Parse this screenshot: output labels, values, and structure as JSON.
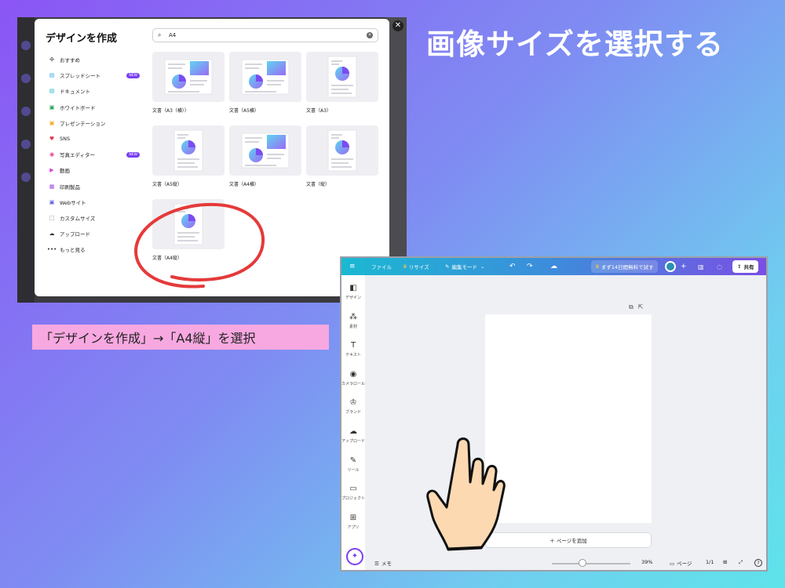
{
  "headline": "画像サイズを選択する",
  "caption": "「デザインを作成」→「A4縦」を選択",
  "dialog": {
    "title": "デザインを作成",
    "search_value": "A4",
    "close_icon": "✕",
    "sidebar": [
      {
        "label": "おすすめ",
        "icon": "sparkle-icon",
        "color": "#333333",
        "badge": ""
      },
      {
        "label": "スプレッドシート",
        "icon": "sheet-icon",
        "color": "#2aa8e0",
        "badge": "NEW"
      },
      {
        "label": "ドキュメント",
        "icon": "doc-icon",
        "color": "#1fb5c4",
        "badge": ""
      },
      {
        "label": "ホワイトボード",
        "icon": "whiteboard-icon",
        "color": "#1aa34a",
        "badge": ""
      },
      {
        "label": "プレゼンテーション",
        "icon": "presentation-icon",
        "color": "#f5a623",
        "badge": ""
      },
      {
        "label": "SNS",
        "icon": "heart-icon",
        "color": "#e5364b",
        "badge": ""
      },
      {
        "label": "写真エディター",
        "icon": "camera-icon",
        "color": "#e83e8c",
        "badge": "NEW"
      },
      {
        "label": "動画",
        "icon": "video-icon",
        "color": "#d63fd6",
        "badge": ""
      },
      {
        "label": "印刷製品",
        "icon": "printer-icon",
        "color": "#9b4de0",
        "badge": ""
      },
      {
        "label": "Webサイト",
        "icon": "website-icon",
        "color": "#5b5fe0",
        "badge": ""
      },
      {
        "label": "カスタムサイズ",
        "icon": "custom-size-icon",
        "color": "#333333",
        "badge": ""
      },
      {
        "label": "アップロード",
        "icon": "upload-icon",
        "color": "#333333",
        "badge": ""
      },
      {
        "label": "もっと見る",
        "icon": "more-icon",
        "color": "#333333",
        "badge": ""
      }
    ],
    "templates": [
      {
        "label": "文書（A3（横））",
        "orientation": "landscape"
      },
      {
        "label": "文書（A5横）",
        "orientation": "landscape"
      },
      {
        "label": "文書（A3）",
        "orientation": "portrait"
      },
      {
        "label": "文書（A5縦）",
        "orientation": "portrait"
      },
      {
        "label": "文書（A4横）",
        "orientation": "landscape"
      },
      {
        "label": "文書（縦）",
        "orientation": "portrait"
      },
      {
        "label": "文書（A4縦）",
        "orientation": "portrait"
      }
    ],
    "highlight_color": "#e53a3a"
  },
  "editor": {
    "menu_icon": "≡",
    "file": "ファイル",
    "resize": "リサイズ",
    "edit_mode": "編集モード",
    "trial": "まず14日間無料で試す",
    "share": "共有",
    "sidebar": [
      {
        "label": "デザイン",
        "icon": "design-icon"
      },
      {
        "label": "素材",
        "icon": "elements-icon"
      },
      {
        "label": "テキスト",
        "icon": "text-icon"
      },
      {
        "label": "カメラロール",
        "icon": "camera-icon"
      },
      {
        "label": "ブランド",
        "icon": "brand-icon"
      },
      {
        "label": "アップロード",
        "icon": "upload-icon"
      },
      {
        "label": "ツール",
        "icon": "tools-icon"
      },
      {
        "label": "プロジェクト",
        "icon": "folder-icon"
      },
      {
        "label": "アプリ",
        "icon": "apps-icon"
      }
    ],
    "add_page": "＋ ページを追加",
    "memo": "メモ",
    "zoom": "39%",
    "pages_label": "ページ",
    "page_count": "1/1",
    "help": "?"
  }
}
